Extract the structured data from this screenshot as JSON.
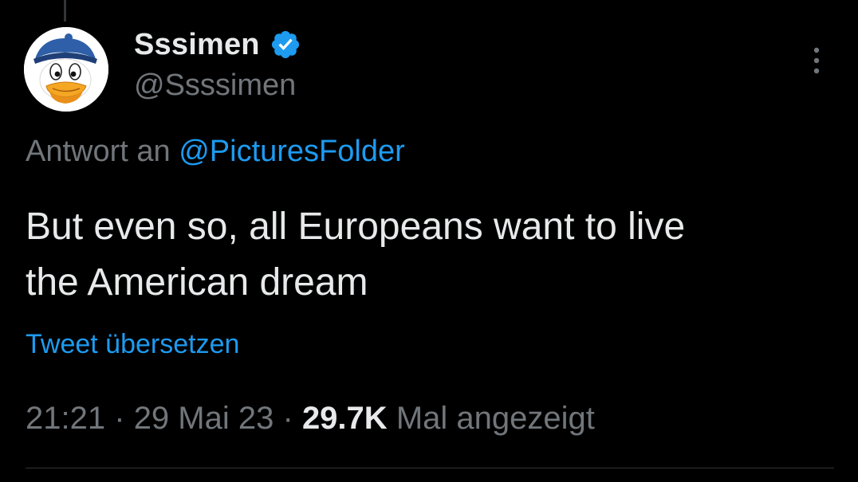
{
  "tweet": {
    "author": {
      "display_name": "Sssimen",
      "handle": "@Ssssimen",
      "verified": true,
      "avatar_icon": "donald-duck-avatar"
    },
    "reply_to": {
      "prefix": "Antwort an",
      "mention": "@PicturesFolder"
    },
    "text_lines": [
      "But even so, all Europeans want to live",
      "the American dream"
    ],
    "translate_label": "Tweet übersetzen",
    "meta": {
      "time": "21:21",
      "separator": "·",
      "date": "29 Mai 23",
      "views_count": "29.7K",
      "views_label": "Mal angezeigt"
    },
    "menu_icon": "more-vertical-icon"
  },
  "colors": {
    "background": "#000000",
    "primary_text": "#e7e9ea",
    "secondary_text": "#71767b",
    "accent": "#1d9bf0",
    "divider": "#2f3336"
  }
}
